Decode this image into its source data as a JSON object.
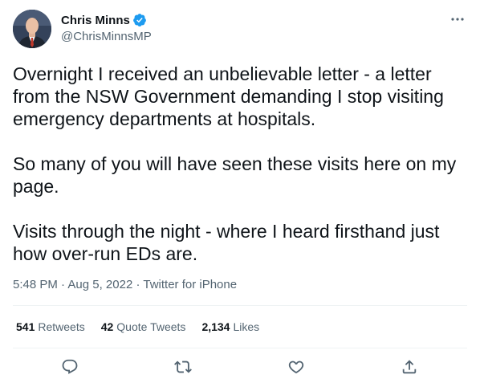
{
  "author": {
    "display_name": "Chris Minns",
    "handle": "@ChrisMinnsMP",
    "verified": true,
    "avatar_icon": "person-avatar-icon"
  },
  "tweet": {
    "paragraphs": [
      "Overnight I received an unbelievable letter - a letter from the NSW Government demanding I stop visiting emergency departments at hospitals.",
      "So many of you will have seen these visits here on my page.",
      "Visits through the night - where I heard firsthand just how over-run EDs are."
    ],
    "time": "5:48 PM",
    "date": "Aug 5, 2022",
    "source": "Twitter for iPhone",
    "separator": " · "
  },
  "stats": {
    "retweets_count": "541",
    "retweets_label": "Retweets",
    "quotes_count": "42",
    "quotes_label": "Quote Tweets",
    "likes_count": "2,134",
    "likes_label": "Likes"
  },
  "colors": {
    "text_primary": "#0f1419",
    "text_secondary": "#536471",
    "verified_blue": "#1d9bf0",
    "divider": "#eff3f4"
  },
  "icons": {
    "more": "more-options-icon",
    "reply": "reply-icon",
    "retweet": "retweet-icon",
    "like": "like-icon",
    "share": "share-icon"
  }
}
